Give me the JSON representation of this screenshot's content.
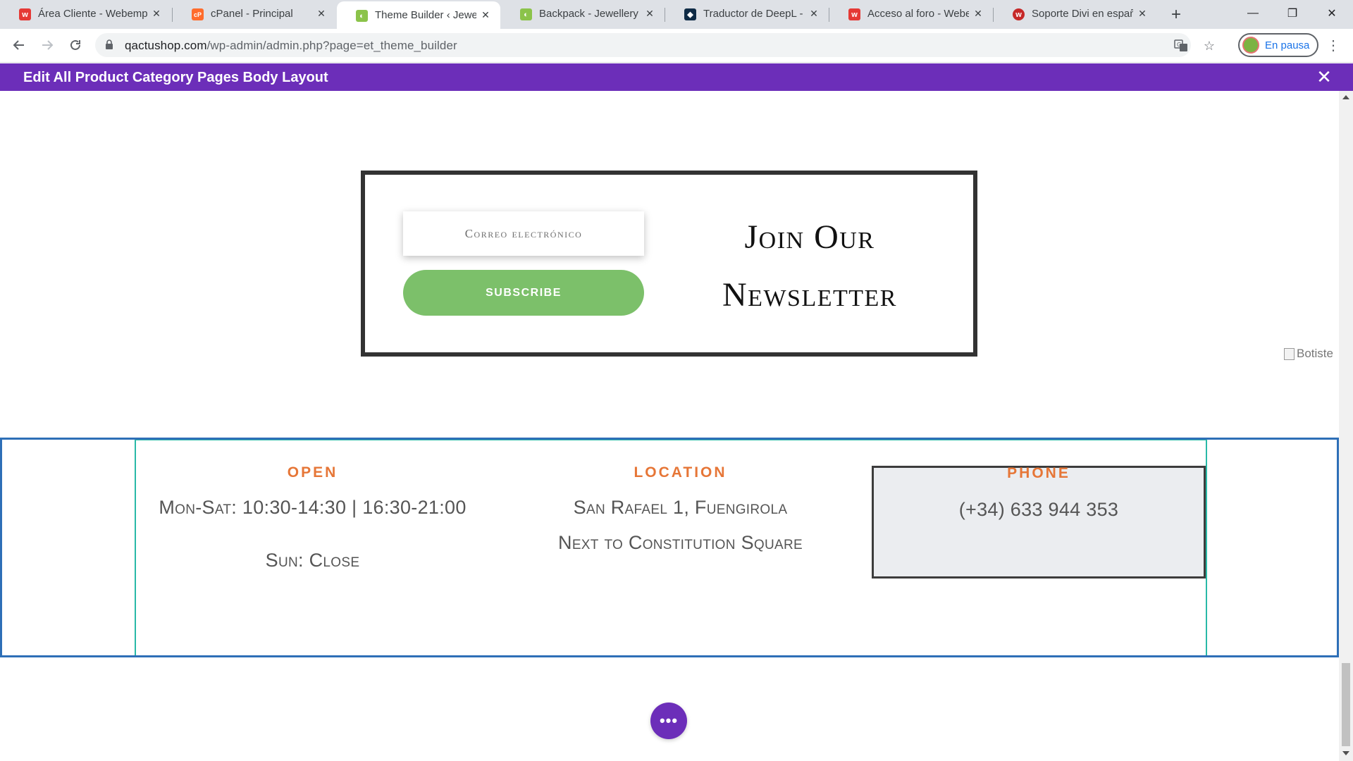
{
  "browser": {
    "tabs": [
      {
        "label": "Área Cliente - Webempresa",
        "favicon": "webempresa-icon",
        "fav_color": "#e53935",
        "fav_text": "w"
      },
      {
        "label": "cPanel - Principal",
        "favicon": "cpanel-icon",
        "fav_color": "#ff6c2c",
        "fav_text": "cP"
      },
      {
        "label": "Theme Builder ‹ Jewellery and",
        "favicon": "divi-builder-icon",
        "fav_color": "#8bc34a",
        "fav_text": "◐"
      },
      {
        "label": "Backpack - Jewellery and",
        "favicon": "divi-builder-icon",
        "fav_color": "#8bc34a",
        "fav_text": "◐"
      },
      {
        "label": "Traductor de DeepL - DeepL",
        "favicon": "deepl-icon",
        "fav_color": "#0f2b46",
        "fav_text": "◆"
      },
      {
        "label": "Acceso al foro - Webempresa",
        "favicon": "webempresa-icon",
        "fav_color": "#e53935",
        "fav_text": "w"
      },
      {
        "label": "Soporte Divi en español",
        "favicon": "webempresa-circle-icon",
        "fav_color": "#c62828",
        "fav_text": "w"
      }
    ],
    "new_tab_label": "+",
    "window_controls": {
      "minimize": "—",
      "maximize": "❐",
      "close": "✕"
    },
    "url_host": "qactushop.com",
    "url_path": "/wp-admin/admin.php?page=et_theme_builder",
    "profile_label": "En pausa"
  },
  "divi": {
    "header_title": "Edit All Product Category Pages Body Layout",
    "close_label": "✕",
    "settings_dots": "•••"
  },
  "newsletter": {
    "email_placeholder": "Correo electrónico",
    "subscribe_label": "SUBSCRIBE",
    "title_line1": "Join Our",
    "title_line2": "Newsletter"
  },
  "broken_image_alt": "Botiste",
  "info": {
    "open": {
      "title": "OPEN",
      "line1": "Mon-Sat: 10:30-14:30 | 16:30-21:00",
      "line2": "Sun: Close"
    },
    "location": {
      "title": "LOCATION",
      "line1": "San Rafael 1, Fuengirola",
      "line2": "Next to Constitution Square"
    },
    "phone": {
      "title": "PHONE",
      "line1": "(+34) 633 944 353"
    }
  },
  "colors": {
    "divi_purple": "#6c2eb9",
    "subscribe_green": "#7cc06a",
    "heading_orange": "#e67637",
    "section_outline_blue": "#2e6fb7",
    "row_outline_teal": "#29b9a7"
  }
}
